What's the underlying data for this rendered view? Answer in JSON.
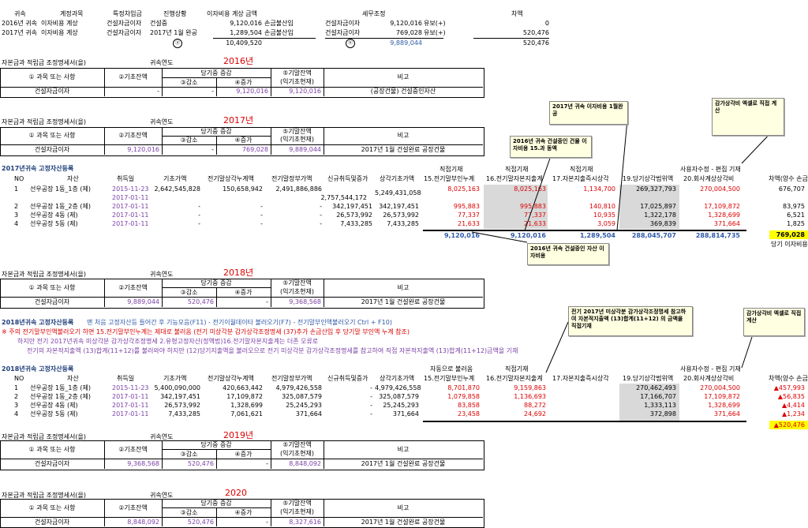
{
  "summary": {
    "headers": [
      "귀속",
      "계정과목",
      "특정차입금",
      "진행상황",
      "이자비용 계상 금액",
      "세무조정",
      "차액"
    ],
    "rows": [
      [
        "2016년 귀속",
        "이자비용 계상",
        "건설자금이자",
        "건설중",
        "9,120,016",
        "손금불산입",
        "건설자금이자",
        "9,120,016",
        "유보(+)",
        "0"
      ],
      [
        "2017년 귀속",
        "이자비용 계상",
        "건설자금이자",
        "2017년 1월 완공",
        "1,289,504",
        "손금불산입",
        "건설자금이자",
        "769,028",
        "유보(+)",
        "520,476"
      ]
    ],
    "totals": {
      "mark_a": "ⓐ",
      "amount": "10,409,520",
      "mark_b": "ⓑ",
      "tax": "9,889,044",
      "diff": "520,476"
    }
  },
  "sched_title": "자본금과 적립금 조정명세서(을)",
  "year_label": "귀속연도",
  "sched_headers": {
    "item": "① 과목 또는 사항",
    "begin": "②기초잔액",
    "change": "당기중 증감",
    "dec": "③감소",
    "inc": "④증가",
    "end1": "⑤기말잔액",
    "end2": "(익기초현재)",
    "note": "비고"
  },
  "sched2016": {
    "year": "2016년",
    "item": "건설자금이자",
    "begin": "-",
    "dec": "-",
    "inc": "9,120,016",
    "end": "9,120,016",
    "note": "(공장건물) 건설중인자산"
  },
  "sched2017": {
    "year": "2017년",
    "item": "건설자금이자",
    "begin": "9,120,016",
    "dec": "-",
    "inc": "769,028",
    "end": "9,889,044",
    "note": "2017년 1월 건설완료 공장건물"
  },
  "sched2018": {
    "year": "2018년",
    "item": "건설자금이자",
    "begin": "9,889,044",
    "dec": "520,476",
    "inc": "-",
    "end": "9,368,568",
    "note": "2017년 1월 건설완료 공장건물"
  },
  "sched2019": {
    "year": "2019년",
    "item": "건설자금이자",
    "begin": "9,368,568",
    "dec": "520,476",
    "inc": "-",
    "end": "8,848,092",
    "note": "2017년 1월 건설완료 공장건물"
  },
  "sched2020": {
    "year": "2020",
    "item": "건설자금이자",
    "begin": "8,848,092",
    "dec": "520,476",
    "inc": "-",
    "end": "8,327,616",
    "note": "2017년 1월 건설완료 공장건물"
  },
  "assets_headers": {
    "no": "NO",
    "asset": "자산",
    "acq": "취득일",
    "base": "기초가액",
    "prev_dep": "전기말상각누계액",
    "prev_book": "전기말장부가액",
    "new": "신규취득및증가",
    "dep_base": "상각기초가액",
    "direct": "직접기재",
    "c15": "15.전기말부인누계",
    "c16": "16.전기말자본지출계",
    "c17": "17.자본지출즉시상각",
    "c19": "19.당기상각범위액",
    "c20": "20.회사계상상각비",
    "adj": "사용자수정 - 편집 기재",
    "diff": "차액(양수 손금"
  },
  "assets2017": {
    "title": "2017년귀속 고정자산등록",
    "rows": [
      {
        "no": "1",
        "name": "선우공장 1동_1층 (제)",
        "date": "2015-11-23",
        "base": "2,642,545,828",
        "prev_dep": "150,658,942",
        "prev_book": "2,491,886,886",
        "new": "",
        "dep_base": "5,249,431,058",
        "c15": "8,025,163",
        "c16": "8,025,163",
        "c17": "1,134,700",
        "c19": "269,327,793",
        "c20": "270,004,500",
        "diff": "676,707"
      },
      {
        "no": "",
        "name": "",
        "date": "2017-01-11",
        "base": "",
        "prev_dep": "",
        "prev_book": "",
        "new": "2,757,544,172",
        "dep_base": "",
        "c15": "",
        "c16": "",
        "c17": "",
        "c19": "",
        "c20": "",
        "diff": ""
      },
      {
        "no": "2",
        "name": "선우공장 1동_2층 (제)",
        "date": "2017-01-11",
        "base": "-",
        "prev_dep": "-",
        "prev_book": "-",
        "new": "342,197,451",
        "dep_base": "342,197,451",
        "c15": "995,883",
        "c16": "995,883",
        "c17": "140,810",
        "c19": "17,025,897",
        "c20": "17,109,872",
        "diff": "83,975"
      },
      {
        "no": "3",
        "name": "선우공장 4동 (제)",
        "date": "2017-01-11",
        "base": "-",
        "prev_dep": "-",
        "prev_book": "-",
        "new": "26,573,992",
        "dep_base": "26,573,992",
        "c15": "77,337",
        "c16": "77,337",
        "c17": "10,935",
        "c19": "1,322,178",
        "c20": "1,328,699",
        "diff": "6,521"
      },
      {
        "no": "4",
        "name": "선우공장 5동 (제)",
        "date": "2017-01-11",
        "base": "-",
        "prev_dep": "-",
        "prev_book": "-",
        "new": "7,433,285",
        "dep_base": "7,433,285",
        "c15": "21,633",
        "c16": "21,633",
        "c17": "3,059",
        "c19": "369,839",
        "c20": "371,664",
        "diff": "1,825"
      }
    ],
    "totals": {
      "c15": "9,120,016",
      "c16": "9,120,016",
      "c17": "1,289,504",
      "c19": "288,045,707",
      "c20": "288,814,735",
      "diff": "769,028"
    },
    "diff_caption": "당기 이자비용"
  },
  "notes2018": {
    "title": "2018년귀속 고정자산등록",
    "line1": "맨 처음 고정자산등 들어간 후 기능모음(F11) - 전기이월데이타 불러오기(F7) - 전기말부인액불러오기 Ctrl + F10)",
    "line2": "※ 주의  전기말부인액불러오기 하면 15.전기말부인누계는 제대로 불러옴 (전기 미상각분 감가상각조정명세  (37)추가 손금산입 후 당기말 부인액 누계 참조)",
    "line3": "하지만  전기 2017년귀속 미상각분 감가상각조정명세 2.유형고정자산(정액법)16.전기말자본지출계는 더존 오류로",
    "line4": "전기의 자본적지출액 (13)합계(11+12)를 불러와야 하지만 (12)당기지출액을 불러오으로 전기 미상각분 감가상각조정명세를 참고하여 직접 자본적지출액 (13)합계(11+12)금액을 기재"
  },
  "assets2018": {
    "title": "2018년귀속 고정자산등록",
    "auto": "자동으로 불러옴",
    "rows": [
      {
        "no": "1",
        "name": "선우공장 1동_1층 (제)",
        "date": "2015-11-23",
        "base": "5,400,090,000",
        "prev_dep": "420,663,442",
        "prev_book": "4,979,426,558",
        "new": "-",
        "dep_base": "4,979,426,558",
        "c15": "8,701,870",
        "c16": "9,159,863",
        "c17": "",
        "c19": "270,462,493",
        "c20": "270,004,500",
        "diff": "▲457,993"
      },
      {
        "no": "2",
        "name": "선우공장 1동_2층 (제)",
        "date": "2017-01-11",
        "base": "342,197,451",
        "prev_dep": "17,109,872",
        "prev_book": "325,087,579",
        "new": "-",
        "dep_base": "325,087,579",
        "c15": "1,079,858",
        "c16": "1,136,693",
        "c17": "",
        "c19": "17,166,707",
        "c20": "17,109,872",
        "diff": "▲56,835"
      },
      {
        "no": "3",
        "name": "선우공장 4동 (제)",
        "date": "2017-01-11",
        "base": "26,573,992",
        "prev_dep": "1,328,699",
        "prev_book": "25,245,293",
        "new": "-",
        "dep_base": "25,245,293",
        "c15": "83,858",
        "c16": "88,272",
        "c17": "",
        "c19": "1,333,113",
        "c20": "1,328,699",
        "diff": "▲4,414"
      },
      {
        "no": "4",
        "name": "선우공장 5동 (제)",
        "date": "2017-01-11",
        "base": "7,433,285",
        "prev_dep": "7,061,621",
        "prev_book": "371,664",
        "new": "-",
        "dep_base": "371,664",
        "c15": "23,458",
        "c16": "24,692",
        "c17": "",
        "c19": "372,898",
        "c20": "371,664",
        "diff": "▲1,234"
      }
    ],
    "total_diff": "▲520,476"
  },
  "comments": {
    "c1": "2017년 귀속 이자비용 1월완공",
    "c2": "2016년 귀속 건설중인 건물 이자비용 15.과 동액",
    "c3": "감가상각비 엑셀로 직접 계산",
    "c4": "2016년 귀속 건설중인 자산 이자비용",
    "c5": "전기 2017년 미상각분 감가상각조정명세 참고하여 자본적지출액 (13)합계(11+12) 의 금액을 직접기재",
    "c6": "감가상각비 엑셀로 직접 계산"
  },
  "colors": {
    "blue": "#2f5aa8",
    "purple": "#7b3fa6",
    "red": "#dd0000",
    "highlight": "#ffff00",
    "gray": "#d9d9d9",
    "note_bg": "#ffffe1"
  }
}
